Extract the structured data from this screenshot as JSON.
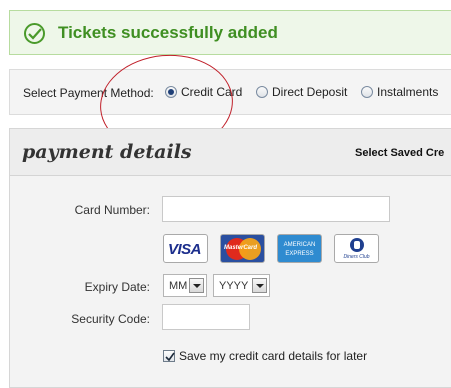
{
  "banner": {
    "message": "Tickets successfully added"
  },
  "payment_method": {
    "label": "Select Payment Method:",
    "options": [
      {
        "label": "Credit Card",
        "selected": true
      },
      {
        "label": "Direct Deposit",
        "selected": false
      },
      {
        "label": "Instalments",
        "selected": false
      }
    ]
  },
  "panel": {
    "title": "payment details",
    "saved_link": "Select Saved Cre"
  },
  "form": {
    "card_number_label": "Card Number:",
    "card_number_value": "",
    "cards": [
      {
        "name": "VISA",
        "icon": "visa-card-icon"
      },
      {
        "name": "MasterCard",
        "icon": "mastercard-icon"
      },
      {
        "name": "AMERICAN EXPRESS",
        "icon": "amex-card-icon"
      },
      {
        "name": "Diners Club",
        "icon": "diners-club-icon"
      }
    ],
    "expiry_label": "Expiry Date:",
    "expiry_month": "MM",
    "expiry_year": "YYYY",
    "security_label": "Security Code:",
    "security_value": "",
    "save_card_label": "Save my credit card details for later",
    "save_card_checked": true
  },
  "colors": {
    "success_green": "#3f8f22",
    "annotation_red": "#c0202a"
  }
}
